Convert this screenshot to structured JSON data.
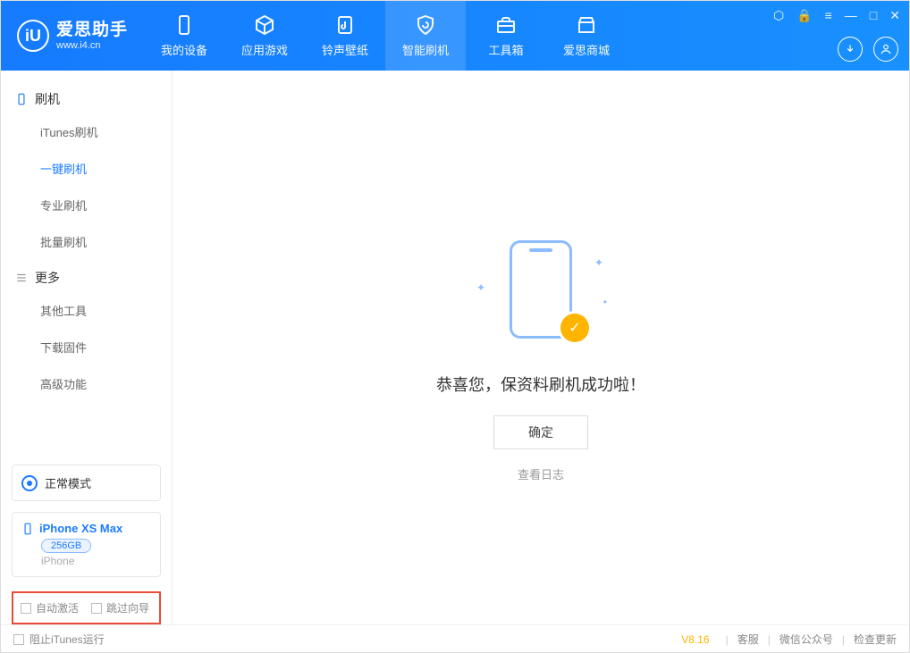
{
  "app": {
    "name_cn": "爱思助手",
    "name_en": "www.i4.cn"
  },
  "tabs": [
    {
      "label": "我的设备"
    },
    {
      "label": "应用游戏"
    },
    {
      "label": "铃声壁纸"
    },
    {
      "label": "智能刷机"
    },
    {
      "label": "工具箱"
    },
    {
      "label": "爱思商城"
    }
  ],
  "sidebar": {
    "group1": {
      "title": "刷机",
      "items": [
        "iTunes刷机",
        "一键刷机",
        "专业刷机",
        "批量刷机"
      ]
    },
    "group2": {
      "title": "更多",
      "items": [
        "其他工具",
        "下载固件",
        "高级功能"
      ]
    },
    "mode": "正常模式",
    "device": {
      "name": "iPhone XS Max",
      "capacity": "256GB",
      "type": "iPhone"
    },
    "checks": {
      "auto_activate": "自动激活",
      "skip_guide": "跳过向导"
    }
  },
  "main": {
    "success_msg": "恭喜您，保资料刷机成功啦！",
    "ok_button": "确定",
    "view_log": "查看日志"
  },
  "statusbar": {
    "block_itunes": "阻止iTunes运行",
    "version": "V8.16",
    "links": [
      "客服",
      "微信公众号",
      "检查更新"
    ]
  }
}
